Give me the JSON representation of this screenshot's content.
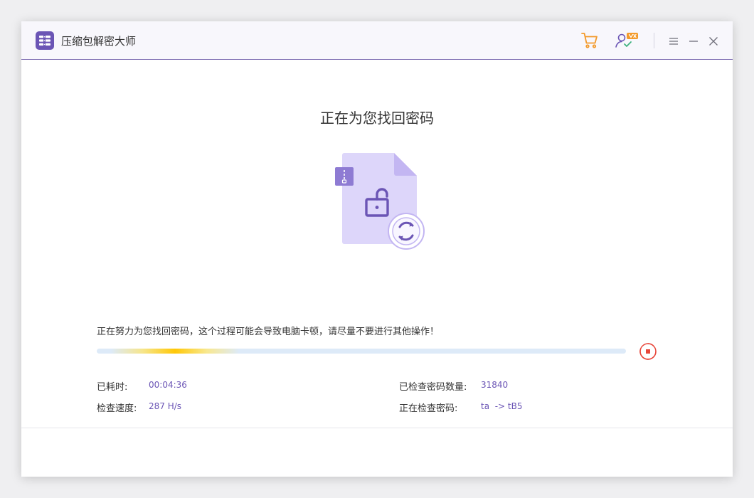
{
  "app": {
    "title": "压缩包解密大师"
  },
  "main": {
    "heading": "正在为您找回密码",
    "notice": "正在努力为您找回密码，这个过程可能会导致电脑卡顿，请尽量不要进行其他操作！",
    "progress": 0.22
  },
  "stats": {
    "elapsed_label": "已耗时:",
    "elapsed_value": "00:04:36",
    "speed_label": "检查速度:",
    "speed_value": "287 H/s",
    "checked_label": "已检查密码数量:",
    "checked_value": "31840",
    "current_label": "正在检查密码:",
    "current_value": "ta  -> tB5"
  },
  "colors": {
    "brand_purple": "#6b55b5",
    "cart_orange": "#f39a2b",
    "stop_red": "#e8463a",
    "progress_track": "#ddeaf8",
    "progress_fill": "#ffc808"
  },
  "icons": {
    "logo": "app-logo-icon",
    "cart": "cart-icon",
    "user": "user-vip-icon",
    "menu": "menu-icon",
    "minimize": "minimize-icon",
    "close": "close-icon",
    "file": "locked-archive-file-icon",
    "stop": "stop-icon"
  }
}
